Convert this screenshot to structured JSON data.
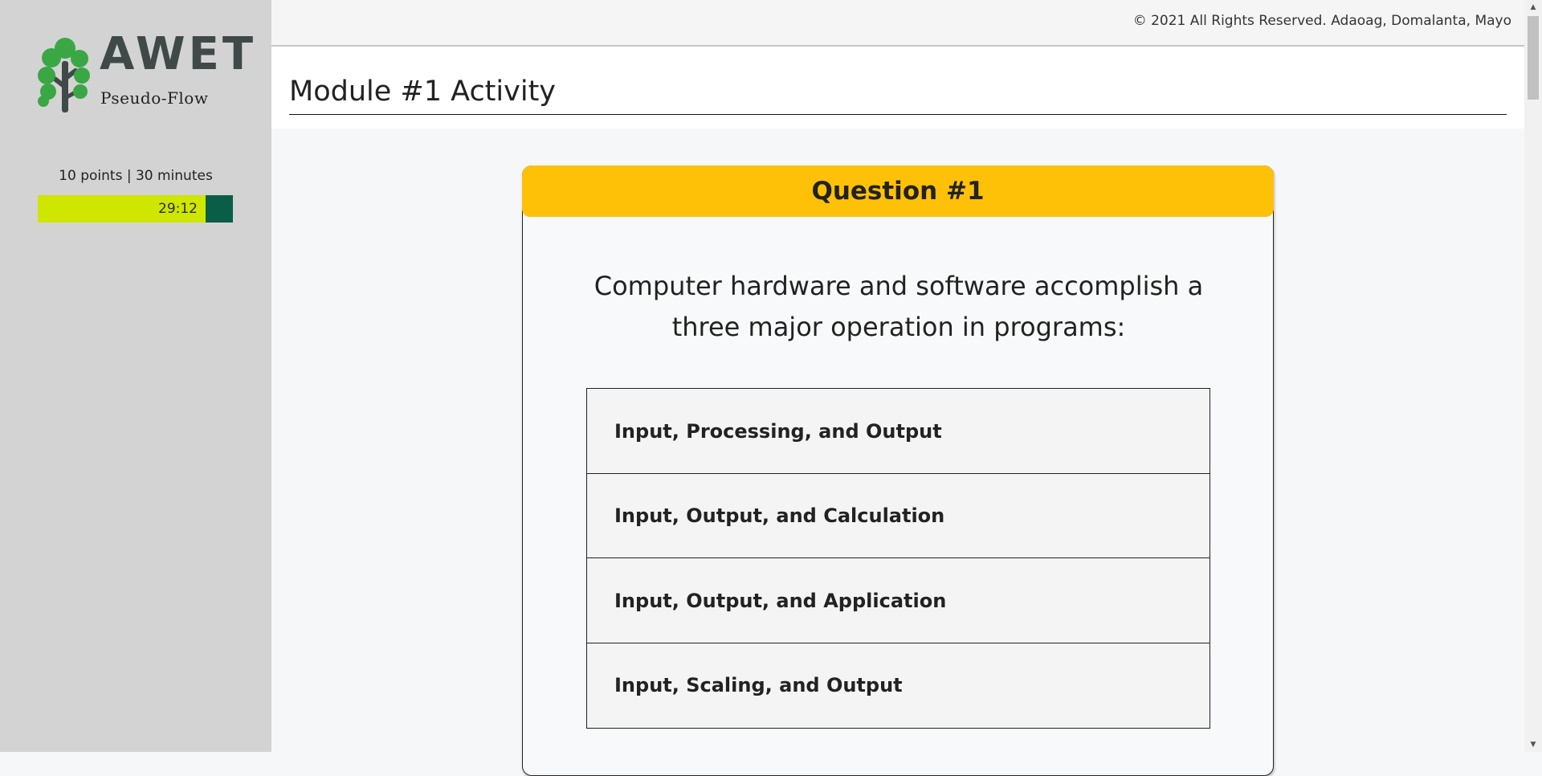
{
  "brand": {
    "name": "AWET",
    "subtitle": "Pseudo-Flow",
    "logo_icon": "tree-icon",
    "colors": {
      "tree": "#3aa745",
      "wordmark": "#3f4a48"
    }
  },
  "timer": {
    "meta": "10 points | 30 minutes",
    "remaining": "29:12",
    "progress_fraction": 0.86,
    "colors": {
      "fill": "#cfe600",
      "track": "#0a5e48"
    }
  },
  "header": {
    "copyright": "© 2021 All Rights Reserved. Adaoag, Domalanta, Mayo"
  },
  "page": {
    "title": "Module #1 Activity"
  },
  "question": {
    "label": "Question #1",
    "text": "Computer hardware and software accomplish a three major operation in programs:",
    "header_color": "#ffc107",
    "options": [
      {
        "label": "Input, Processing, and Output"
      },
      {
        "label": "Input, Output, and Calculation"
      },
      {
        "label": "Input, Output, and Application"
      },
      {
        "label": "Input, Scaling, and Output"
      }
    ]
  },
  "scrollbar": {
    "up_icon": "scroll-up-arrow-icon",
    "down_icon": "scroll-down-arrow-icon"
  }
}
